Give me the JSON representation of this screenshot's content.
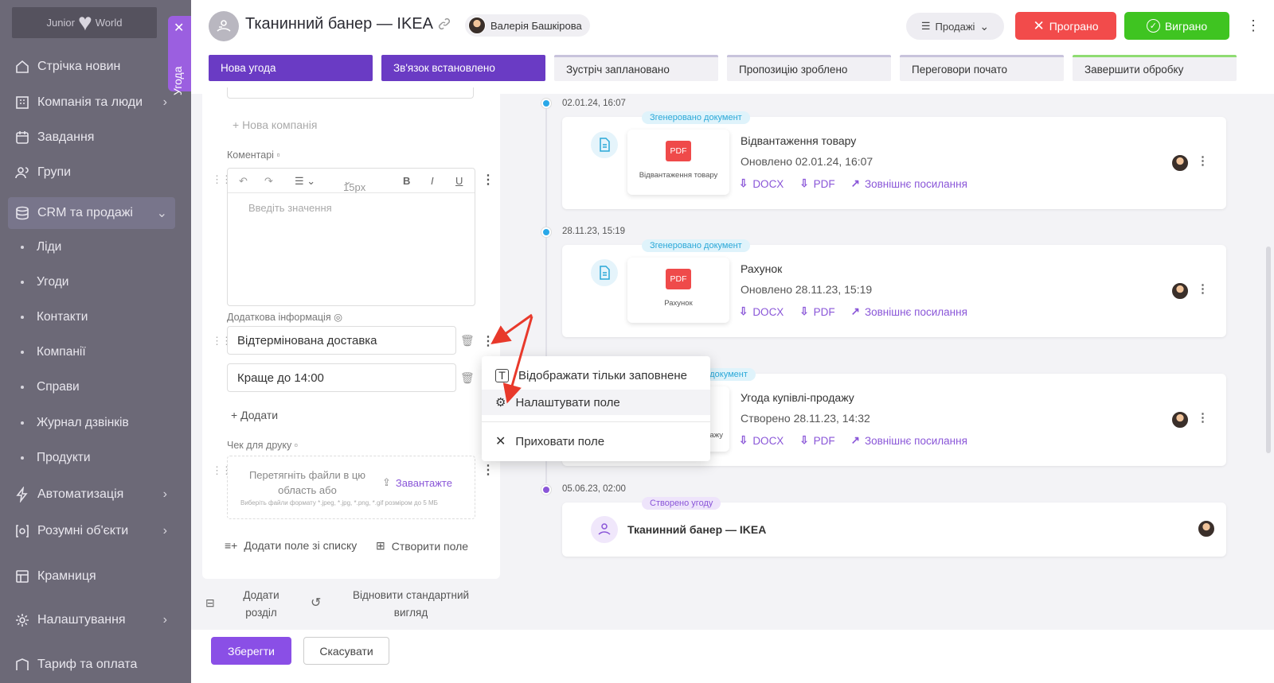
{
  "sidebar": {
    "logo_text_left": "Junior",
    "logo_text_right": "World",
    "items": [
      {
        "label": "Стрічка новин",
        "icon": "home-icon"
      },
      {
        "label": "Компанія та люди",
        "icon": "building-icon"
      },
      {
        "label": "Завдання",
        "icon": "calendar-icon"
      },
      {
        "label": "Групи",
        "icon": "users-icon"
      },
      {
        "label": "CRM та продажі",
        "icon": "database-icon"
      },
      {
        "label": "Автоматизація",
        "icon": "bolt-icon"
      },
      {
        "label": "Розумні об'єкти",
        "icon": "smart-object-icon"
      },
      {
        "label": "Крамниця",
        "icon": "store-icon"
      },
      {
        "label": "Налаштування",
        "icon": "gear-icon"
      },
      {
        "label": "Тариф та оплата",
        "icon": "tariff-icon"
      }
    ],
    "crm_sub": [
      "Ліди",
      "Угоди",
      "Контакти",
      "Компанії",
      "Справи",
      "Журнал дзвінків",
      "Продукти"
    ]
  },
  "deal_tab": {
    "label": "Угода"
  },
  "header": {
    "title": "Тканинний банер — IKEA",
    "owner": "Валерія Башкірова",
    "pipeline": "Продажі",
    "lost_label": "Програно",
    "won_label": "Виграно"
  },
  "stages": [
    {
      "label": "Нова угода"
    },
    {
      "label": "Зв'язок встановлено"
    },
    {
      "label": "Зустріч заплановано"
    },
    {
      "label": "Пропозицію зроблено"
    },
    {
      "label": "Переговори почато"
    },
    {
      "label": "Завершити обробку"
    }
  ],
  "form": {
    "new_company": "+ Нова компанія",
    "comments_label": "Коментарі",
    "editor_font_size": "15px",
    "editor_placeholder": "Введіть значення",
    "extra_info_label": "Додаткова інформація",
    "extra_value_1": "Відтермінована доставка",
    "extra_value_2": "Краще до 14:00",
    "add_label": "+ Додати",
    "receipt_label": "Чек для друку",
    "dropzone_text": "Перетягніть файли в цю область або",
    "upload_label": "Завантажте",
    "dropzone_hint": "Виберіть файли формату *.jpeg, *.jpg, *.png, *.gif розміром до 5 МБ",
    "add_field_from_list": "Додати поле зі списку",
    "create_field": "Створити поле"
  },
  "bottom": {
    "add_section": "Додати розділ",
    "restore_default": "Відновити стандартний вигляд",
    "save": "Зберегти",
    "cancel": "Скасувати"
  },
  "timeline": [
    {
      "time": "02.01.24, 16:07",
      "tag": "Згенеровано документ",
      "title": "Відвантаження товару",
      "updated": "Оновлено 02.01.24, 16:07",
      "thumb": "Відвантаження товару"
    },
    {
      "time": "28.11.23, 15:19",
      "tag": "Згенеровано документ",
      "title": "Рахунок",
      "updated": "Оновлено 28.11.23, 15:19",
      "thumb": "Рахунок"
    },
    {
      "time": "",
      "tag": "но документ",
      "title": "Угода купівлі-продажу",
      "updated": "Створено 28.11.23, 14:32",
      "thumb": "одажу"
    },
    {
      "time": "05.06.23, 02:00",
      "tag": "Створено угоду",
      "title": "Тканинний банер — IKEA"
    }
  ],
  "doc_links": {
    "docx": "DOCX",
    "pdf": "PDF",
    "external": "Зовнішнє посилання",
    "pdf_badge": "PDF"
  },
  "context_menu": [
    {
      "label": "Відображати тільки заповнене"
    },
    {
      "label": "Налаштувати поле"
    },
    {
      "label": "Приховати поле"
    }
  ],
  "colors": {
    "accent": "#8a4fe6",
    "stage_done": "#6a3bc4",
    "lost": "#f24b4b",
    "won": "#3fc421",
    "timeline_blue": "#2aa8e8",
    "timeline_purple": "#8a56d8"
  }
}
